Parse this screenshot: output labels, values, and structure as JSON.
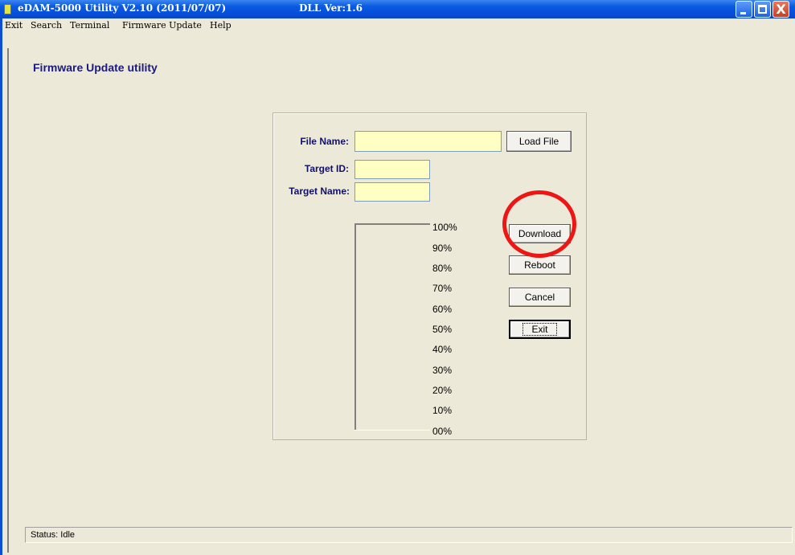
{
  "window": {
    "title": "eDAM-5000 Utility  V2.10 (2011/07/07)",
    "dll_version": "DLL Ver:1.6",
    "close_glyph": "X"
  },
  "menu": [
    "Exit",
    "Search",
    "Terminal",
    "Firmware Update",
    "Help"
  ],
  "page": {
    "title": "Firmware Update utility"
  },
  "form": {
    "file_name_label": "File Name:",
    "file_name_value": "",
    "target_id_label": "Target ID:",
    "target_id_value": "",
    "target_name_label": "Target Name:",
    "target_name_value": ""
  },
  "buttons": {
    "load_file": "Load File",
    "download": "Download",
    "reboot": "Reboot",
    "cancel": "Cancel",
    "exit": "Exit"
  },
  "progress": {
    "value_percent": 0,
    "ticks": [
      "100%",
      "90%",
      "80%",
      "70%",
      "60%",
      "50%",
      "40%",
      "30%",
      "20%",
      "10%",
      "00%"
    ]
  },
  "status": {
    "text": "Status: Idle"
  },
  "colors": {
    "titlebar": "#0650dc",
    "input_bg": "#ffffc4",
    "label": "#10106a",
    "highlight": "#ee1515"
  },
  "icons": {
    "app": "app-icon",
    "minimize": "minimize-icon",
    "maximize": "maximize-icon",
    "close": "close-icon"
  }
}
